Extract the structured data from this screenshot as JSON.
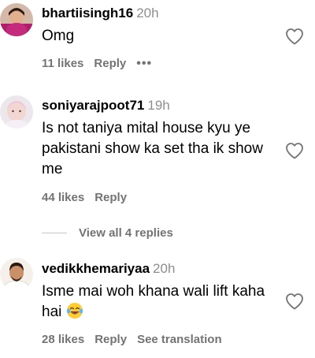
{
  "comments": [
    {
      "username": "bhartiisingh16",
      "time": "20h",
      "text": "Omg",
      "likes": "11 likes",
      "reply": "Reply",
      "more": "•••",
      "avatar_icon": "avatar-photo"
    },
    {
      "username": "soniyarajpoot71",
      "time": "19h",
      "text": "Is not taniya mital house kyu ye pakistani show ka set tha ik show me",
      "likes": "44 likes",
      "reply": "Reply",
      "avatar_icon": "avatar-photo"
    },
    {
      "username": "vedikkhemariyaa",
      "time": "20h",
      "text": "Isme mai woh khana wali lift kaha hai",
      "emoji": "tears-of-joy-emoji",
      "likes": "28 likes",
      "reply": "Reply",
      "see_translation": "See translation",
      "avatar_icon": "avatar-photo"
    }
  ],
  "view_replies": "View all 4 replies",
  "icons": {
    "like": "heart-outline-icon"
  },
  "colors": {
    "text": "#000000",
    "secondary": "#737373",
    "timestamp": "#8e8e8e"
  }
}
